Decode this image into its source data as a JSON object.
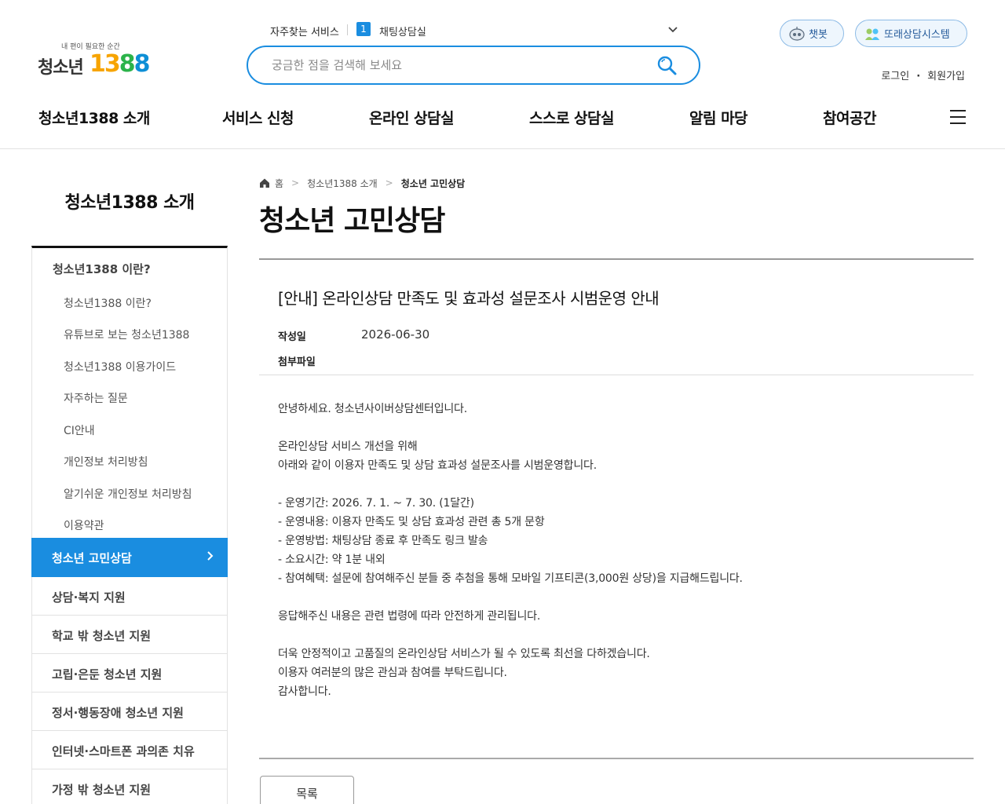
{
  "logo": {
    "tagline": "내 편이 필요한 순간",
    "name": "청소년",
    "number": "1388"
  },
  "quick": {
    "label": "자주찾는 서비스",
    "badge": "1",
    "item": "채팅상담실"
  },
  "search": {
    "placeholder": "궁금한 점을 검색해 보세요"
  },
  "header_buttons": {
    "chatbot": "챗봇",
    "peer": "또래상담시스템"
  },
  "account": {
    "login": "로그인",
    "signup": "회원가입"
  },
  "gnb": [
    "청소년1388 소개",
    "서비스 신청",
    "온라인 상담실",
    "스스로 상담실",
    "알림 마당",
    "참여공간"
  ],
  "sidebar": {
    "title": "청소년1388 소개",
    "group": "청소년1388 이란?",
    "subs": [
      "청소년1388 이란?",
      "유튜브로 보는 청소년1388",
      "청소년1388 이용가이드",
      "자주하는 질문",
      "CI안내",
      "개인정보 처리방침",
      "알기쉬운 개인정보 처리방침",
      "이용약관"
    ],
    "active": "청소년 고민상담",
    "mains": [
      "상담·복지 지원",
      "학교 밖 청소년 지원",
      "고립·은둔 청소년 지원",
      "정서·행동장애 청소년 지원",
      "인터넷·스마트폰 과의존 치유",
      "가정 밖 청소년 지원"
    ]
  },
  "breadcrumb": {
    "home": "홈",
    "level1": "청소년1388 소개",
    "current": "청소년 고민상담"
  },
  "page_title": "청소년 고민상담",
  "post": {
    "title": "[안내] 온라인상담 만족도 및 효과성 설문조사 시범운영 안내",
    "date_label": "작성일",
    "date": "2026-06-30",
    "attach_label": "첨부파일",
    "body": [
      "안녕하세요. 청소년사이버상담센터입니다.",
      "",
      "온라인상담 서비스 개선을 위해",
      "아래와 같이 이용자 만족도 및 상담 효과성 설문조사를 시범운영합니다.",
      "",
      "- 운영기간: 2026. 7. 1. ~ 7. 30. (1달간)",
      "- 운영내용: 이용자 만족도 및 상담 효과성 관련 총 5개 문항",
      "- 운영방법: 채팅상담 종료 후 만족도 링크 발송",
      "- 소요시간: 약 1분 내외",
      "- 참여혜택: 설문에 참여해주신 분들 중 추첨을 통해 모바일 기프티콘(3,000원 상당)을 지급해드립니다.",
      "",
      "응답해주신 내용은 관련 법령에 따라 안전하게 관리됩니다.",
      "",
      "더욱 안정적이고 고품질의 온라인상담 서비스가 될 수 있도록 최선을 다하겠습니다.",
      "이용자 여러분의 많은 관심과 참여를 부탁드립니다.",
      "감사합니다."
    ]
  },
  "list_button": "목록",
  "icons": {
    "search": "search-icon",
    "home": "home-icon",
    "menu": "menu-icon",
    "chevron": "chevron-down-icon",
    "chatbot": "robot-icon",
    "peer": "people-icon"
  },
  "colors": {
    "accent": "#1a8de0"
  }
}
